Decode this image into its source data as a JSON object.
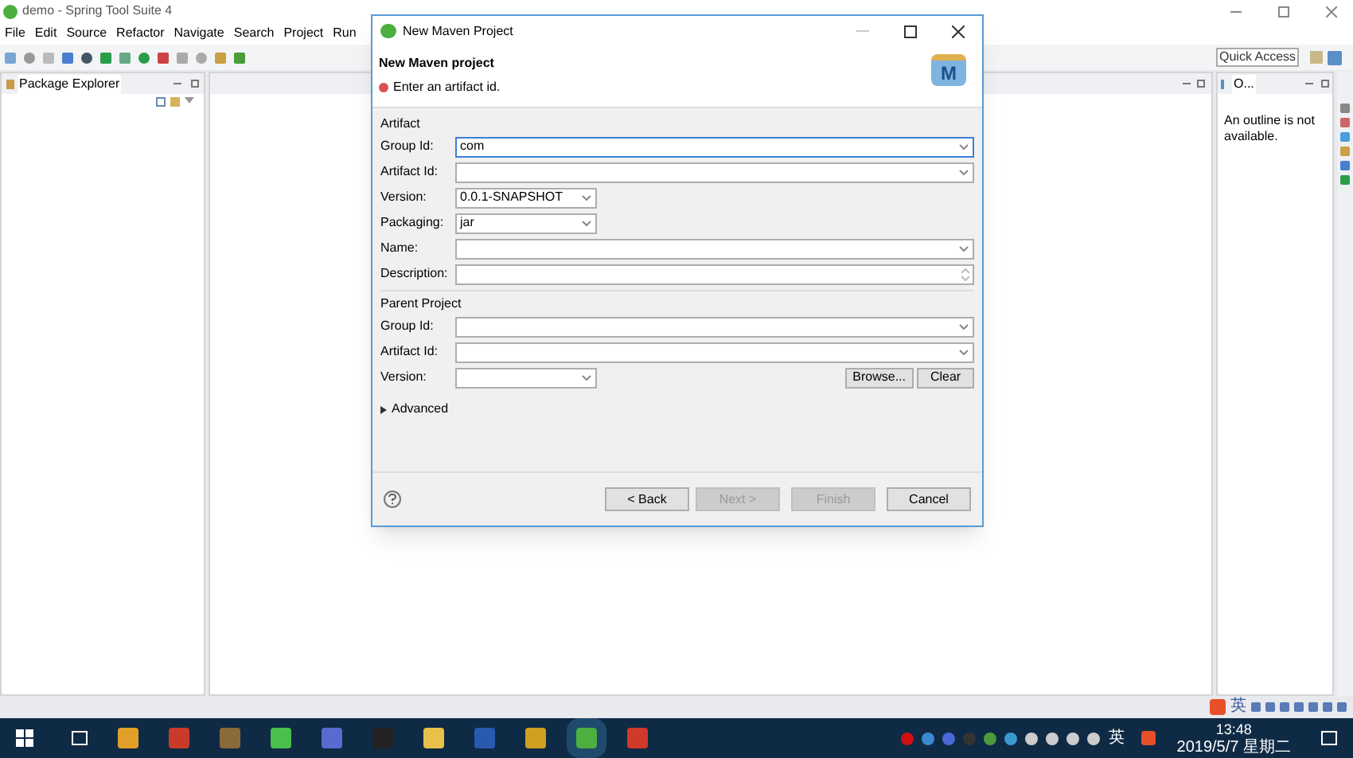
{
  "ide": {
    "title": "demo - Spring Tool Suite 4",
    "menu": [
      "File",
      "Edit",
      "Source",
      "Refactor",
      "Navigate",
      "Search",
      "Project",
      "Run"
    ],
    "quick_access": {
      "placeholder": "Quick Access"
    },
    "package_explorer": {
      "label": "Package Explorer"
    },
    "outline": {
      "label": "O...",
      "message": "An outline is not available."
    }
  },
  "dialog": {
    "title": "New Maven Project",
    "heading": "New Maven project",
    "error": "Enter an artifact id.",
    "logo_letter": "M",
    "sections": [
      {
        "label": "Artifact",
        "fields": [
          {
            "label": "Group Id:",
            "value": "com",
            "kind": "combo",
            "focused": true
          },
          {
            "label": "Artifact Id:",
            "kind": "combo",
            "focused": false
          },
          {
            "label": "Version:",
            "value": "0.0.1-SNAPSHOT",
            "kind": "short-combo",
            "focused": false
          },
          {
            "label": "Packaging:",
            "value": "jar",
            "kind": "short-combo",
            "focused": false
          },
          {
            "label": "Name:",
            "kind": "combo",
            "focused": false
          },
          {
            "label": "Description:",
            "kind": "textarea",
            "focused": false
          }
        ]
      },
      {
        "label": "Parent Project",
        "fields": [
          {
            "label": "Group Id:",
            "kind": "combo",
            "focused": false
          },
          {
            "label": "Artifact Id:",
            "kind": "combo",
            "focused": false
          },
          {
            "label": "Version:",
            "kind": "short-combo",
            "focused": false
          }
        ]
      }
    ],
    "parent_buttons": [
      "Browse...",
      "Clear"
    ],
    "advanced": {
      "label": "Advanced",
      "expanded": false
    },
    "buttons": [
      {
        "label": "< Back",
        "disabled": false
      },
      {
        "label": "Next >",
        "disabled": true
      },
      {
        "label": "Finish",
        "disabled": true
      },
      {
        "label": "Cancel",
        "disabled": false
      }
    ]
  },
  "ime_bar": {
    "mode": "英"
  },
  "taskbar": {
    "ime": "英",
    "time": "13:48",
    "date": "2019/5/7 星期二"
  }
}
